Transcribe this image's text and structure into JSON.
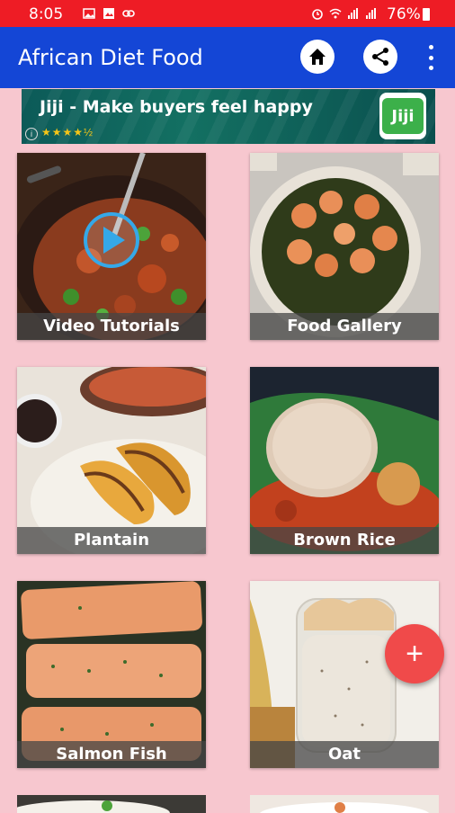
{
  "status": {
    "time": "8:05",
    "battery": "76%"
  },
  "appbar": {
    "title": "African Diet Food",
    "icons": [
      "home-icon",
      "share-icon",
      "more-vert-icon"
    ]
  },
  "ad": {
    "headline": "Jiji - Make buyers feel happy",
    "rating_stars": 4.5,
    "logo_text": "Jiji"
  },
  "cards": [
    {
      "label": "Video Tutorials"
    },
    {
      "label": "Food Gallery"
    },
    {
      "label": "Plantain"
    },
    {
      "label": "Brown Rice"
    },
    {
      "label": "Salmon Fish"
    },
    {
      "label": "Oat"
    }
  ],
  "fab": {
    "label": "+"
  },
  "colors": {
    "statusbar": "#ee1c25",
    "appbar": "#1446d6",
    "background": "#f7c7cf",
    "fab": "#f04a4a"
  }
}
